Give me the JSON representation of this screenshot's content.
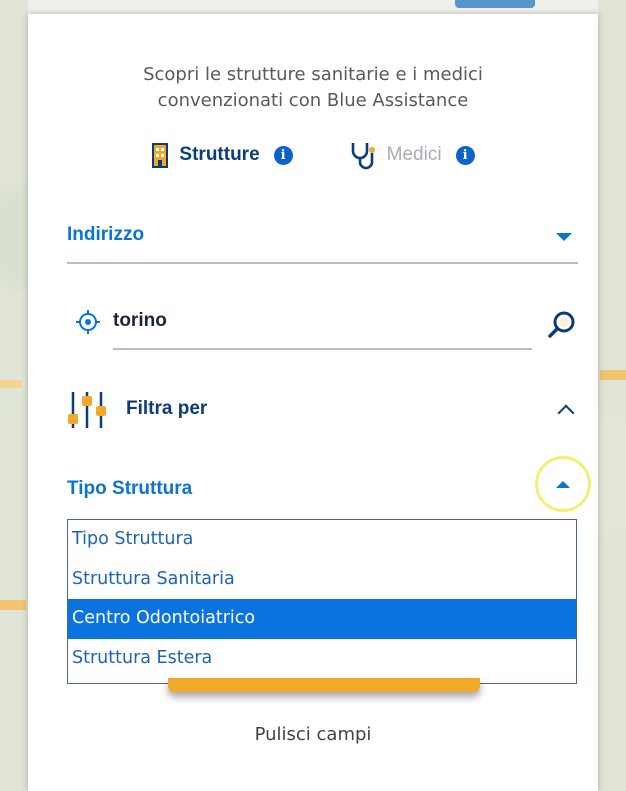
{
  "intro": {
    "line1": "Scopri le strutture sanitarie e i medici",
    "line2": "convenzionati con Blue Assistance"
  },
  "tabs": [
    {
      "label": "Strutture",
      "active": true,
      "icon": "building-icon"
    },
    {
      "label": "Medici",
      "active": false,
      "icon": "stethoscope-icon"
    }
  ],
  "address_select": {
    "label": "Indirizzo"
  },
  "search": {
    "value": "torino",
    "icon": "search-icon",
    "location_icon": "locate-icon"
  },
  "filter": {
    "title": "Filtra per",
    "icon": "sliders-icon"
  },
  "structure_type": {
    "label": "Tipo Struttura",
    "options": [
      "Tipo Struttura",
      "Struttura Sanitaria",
      "Centro Odontoiatrico",
      "Struttura Estera"
    ],
    "highlighted_index": 2
  },
  "clear_label": "Pulisci campi",
  "colors": {
    "primary_blue": "#0a75d1",
    "dark_navy": "#0a3d7a",
    "accent_orange": "#f0a92b",
    "option_highlight": "#0b73e0"
  }
}
